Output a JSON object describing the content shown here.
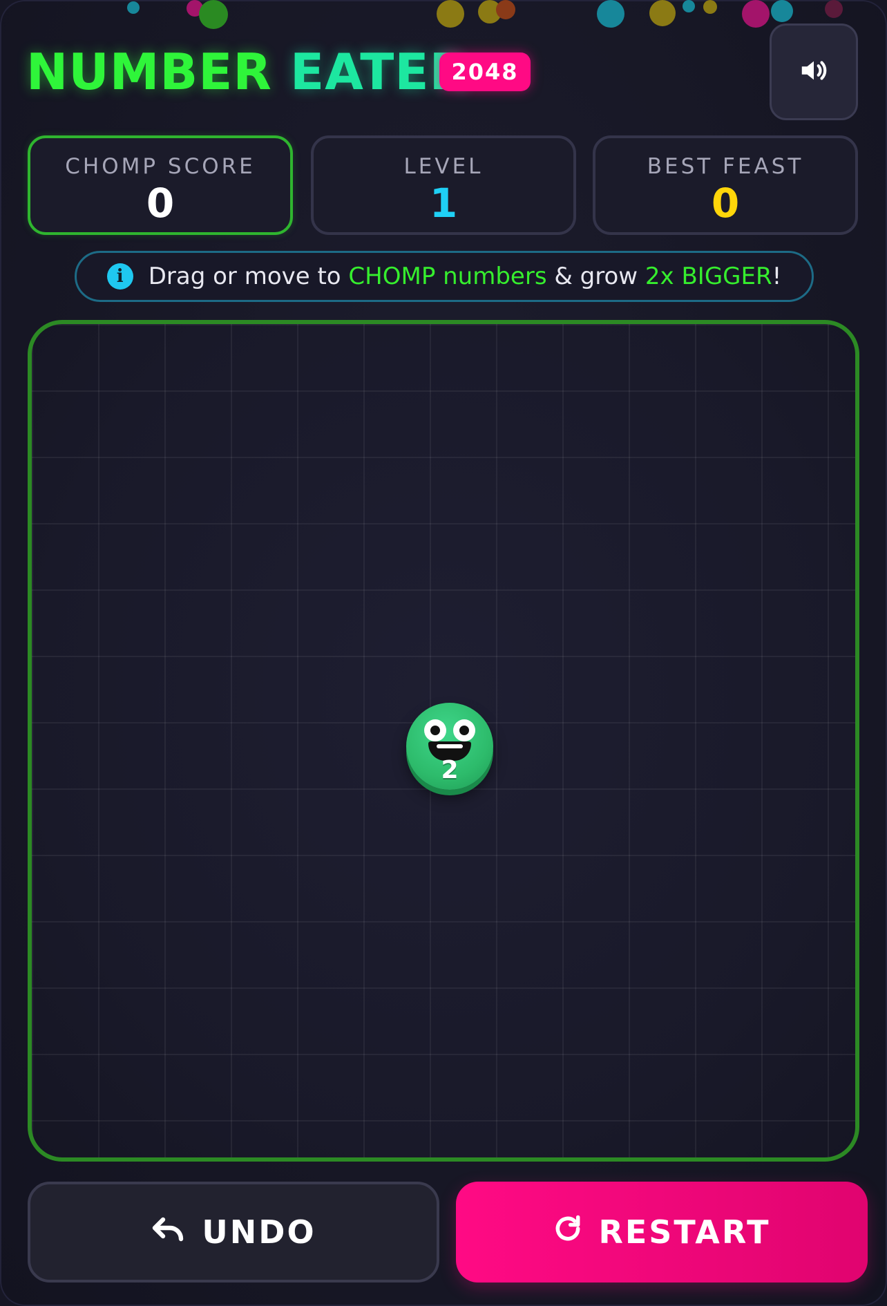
{
  "header": {
    "title_part1": "NUMBER",
    "title_part2": "EATER",
    "badge": "2048",
    "sound_icon": "speaker-volume-icon"
  },
  "stats": [
    {
      "label": "CHOMP SCORE",
      "value": "0",
      "color": "#ffffff"
    },
    {
      "label": "LEVEL",
      "value": "1",
      "color": "#1fd0f5"
    },
    {
      "label": "BEST FEAST",
      "value": "0",
      "color": "#ffd60a"
    }
  ],
  "hint": {
    "icon": "info-icon",
    "text_1": "Drag or move to ",
    "highlight_1": "CHOMP numbers",
    "text_2": " & grow ",
    "highlight_2": "2x BIGGER",
    "text_3": "!"
  },
  "board": {
    "eater_value": "2",
    "eater_color": "#2dbb6b"
  },
  "actions": {
    "undo_label": "UNDO",
    "undo_icon": "undo-arrow-icon",
    "restart_label": "RESTART",
    "restart_icon": "restart-icon"
  },
  "colors": {
    "accent_green": "#2ff53a",
    "accent_teal": "#1de7a0",
    "accent_pink": "#ff0a84",
    "board_border": "#2c8a24"
  }
}
